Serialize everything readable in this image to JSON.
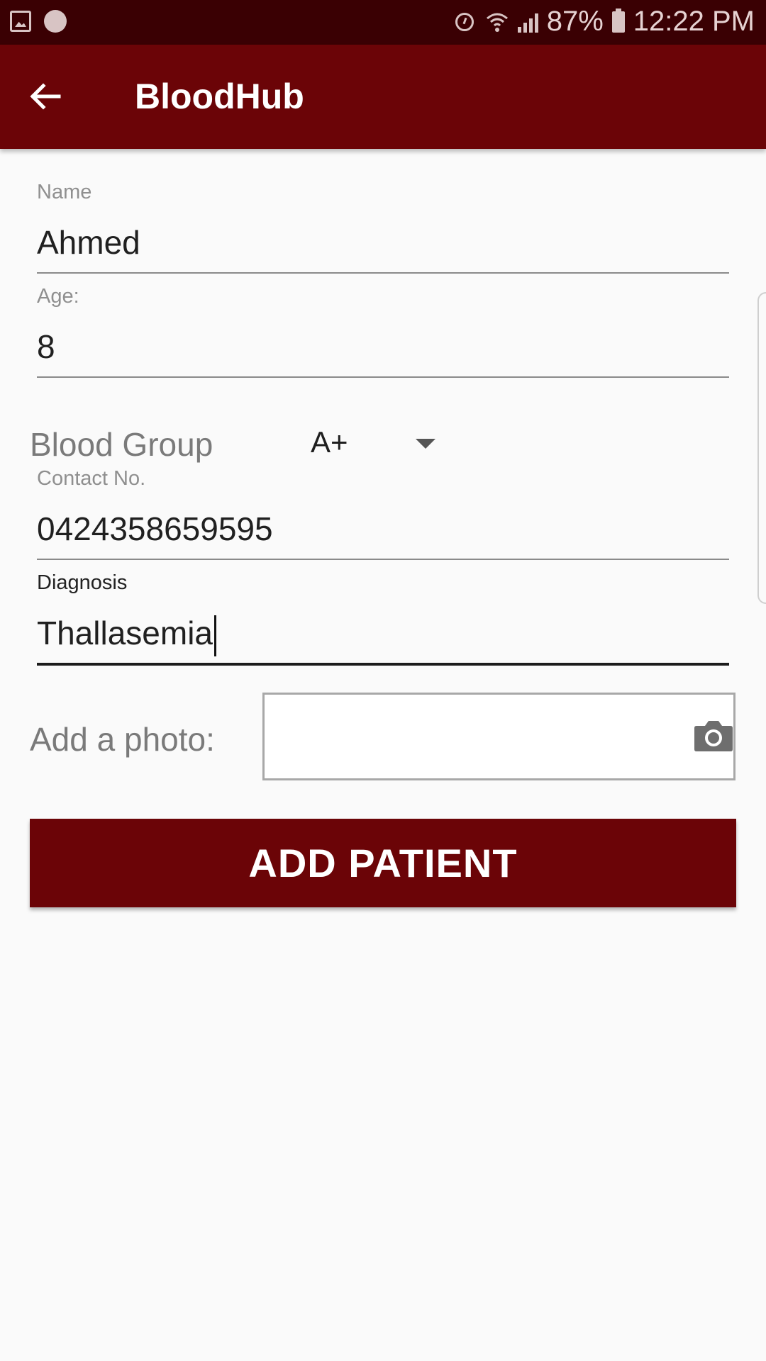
{
  "status_bar": {
    "battery": "87%",
    "time": "12:22 PM",
    "icons": [
      "gallery-icon",
      "circle-icon",
      "alarm-icon",
      "wifi-icon",
      "signal-icon",
      "battery-icon"
    ]
  },
  "app_bar": {
    "title": "BloodHub",
    "back_icon": "arrow-back-icon",
    "background": "#6b0407"
  },
  "form": {
    "name": {
      "label": "Name",
      "value": "Ahmed"
    },
    "age": {
      "label": "Age:",
      "value": "8"
    },
    "blood_group": {
      "label": "Blood Group",
      "selected": "A+"
    },
    "contact": {
      "label": "Contact No.",
      "value": "0424358659595"
    },
    "diagnosis": {
      "label": "Diagnosis",
      "value": "Thallasemia"
    },
    "photo": {
      "label": "Add a photo:",
      "icon": "camera-icon"
    }
  },
  "actions": {
    "add_patient_label": "ADD PATIENT"
  },
  "colors": {
    "status_bar": "#3a0003",
    "accent": "#6b0407",
    "background": "#fafafa"
  }
}
